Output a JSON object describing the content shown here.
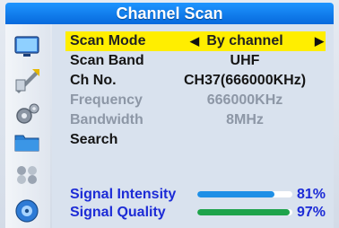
{
  "title": "Channel Scan",
  "menu": [
    {
      "label": "Scan Mode",
      "value": "By channel"
    },
    {
      "label": "Scan Band",
      "value": "UHF"
    },
    {
      "label": "Ch No.",
      "value": "CH37(666000KHz)"
    },
    {
      "label": "Frequency",
      "value": "666000KHz"
    },
    {
      "label": "Bandwidth",
      "value": "8MHz"
    },
    {
      "label": "Search",
      "value": ""
    }
  ],
  "arrows": {
    "left": "◀",
    "right": "▶"
  },
  "signal": {
    "intensity": {
      "label": "Signal Intensity",
      "percent": "81%",
      "level": 81
    },
    "quality": {
      "label": "Signal Quality",
      "percent": "97%",
      "level": 97
    }
  },
  "colors": {
    "title_bar": "#1a8cf5",
    "highlight": "#ffee00",
    "signal_text": "#1c2bd6",
    "intensity_bar": "#1e8fe6",
    "quality_bar": "#1ea34b"
  },
  "sidebar_icons": [
    "tv-icon",
    "installation-wrench-icon",
    "settings-gear-icon",
    "folder-icon",
    "media-icon",
    "disc-icon"
  ]
}
